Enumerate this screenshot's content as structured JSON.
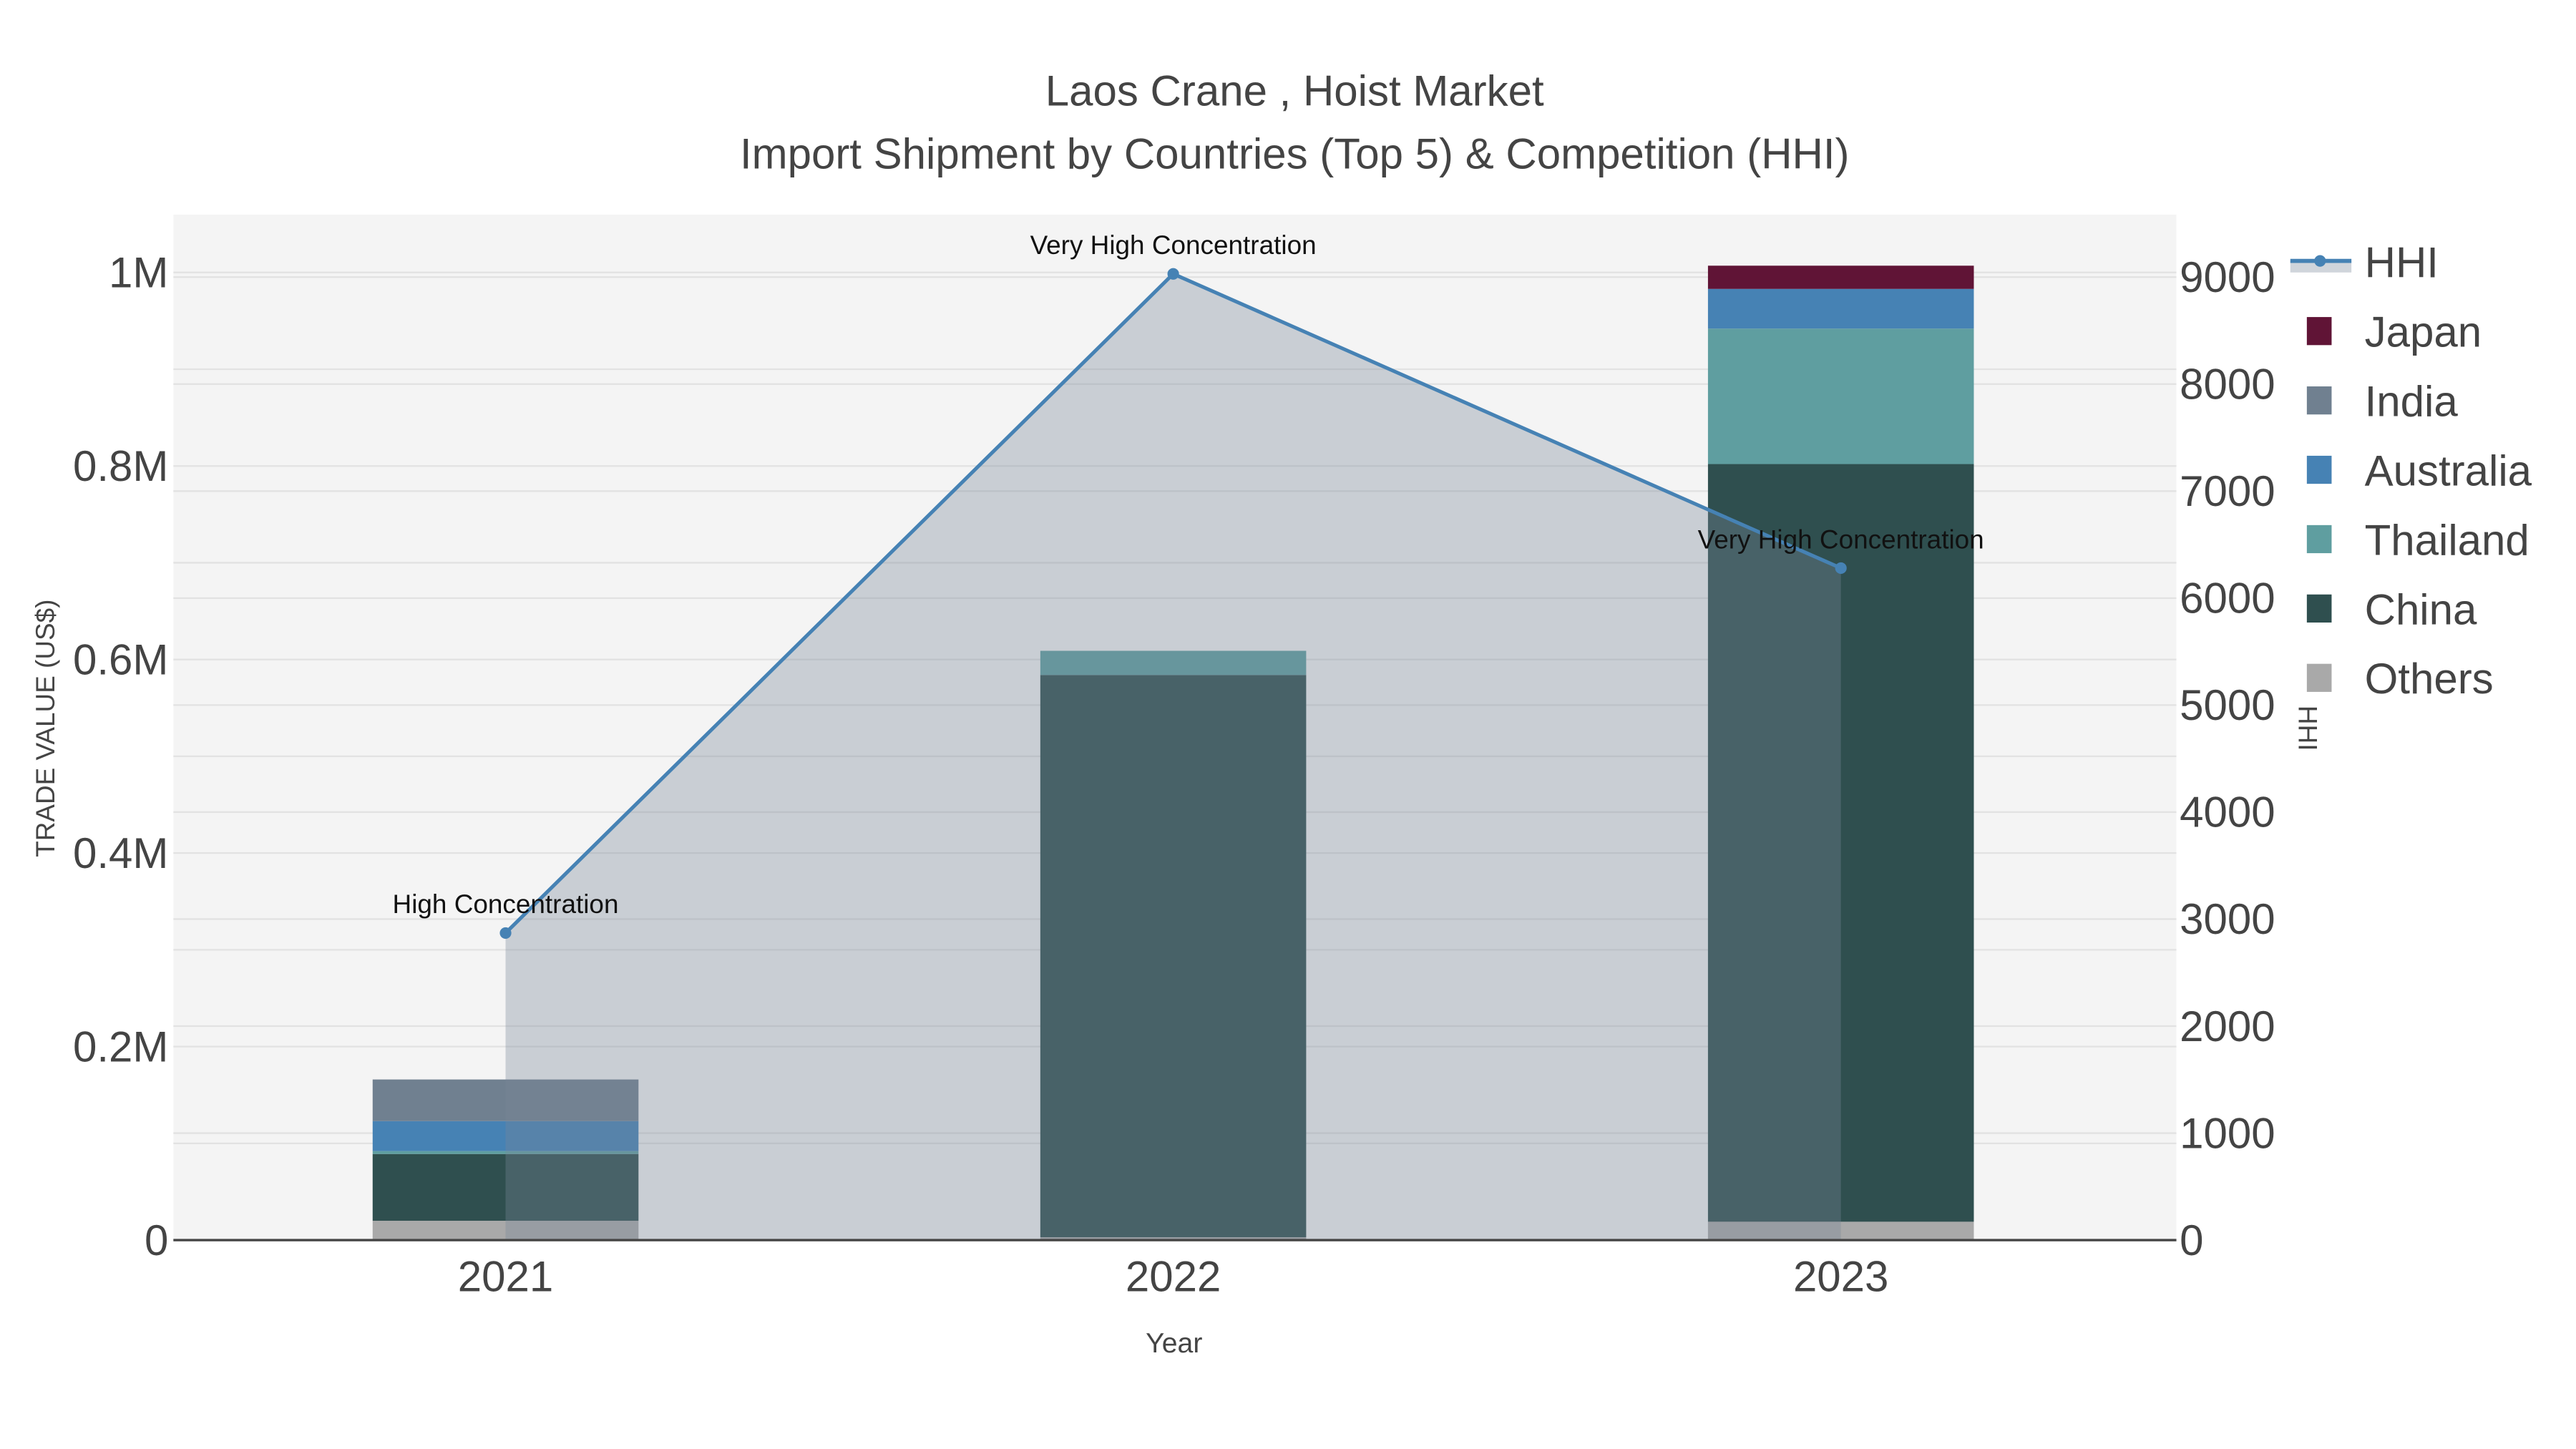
{
  "chart_data": {
    "type": "bar",
    "title": "Laos Crane , Hoist Market",
    "subtitle": "Import Shipment by Countries (Top 5) & Competition (HHI)",
    "xlabel": "Year",
    "ylabel": "TRADE VALUE (US$)",
    "y2label": "HHI",
    "categories": [
      "2021",
      "2022",
      "2023"
    ],
    "ylim": [
      0,
      1060000
    ],
    "y2lim": [
      0,
      9600
    ],
    "yticks": [
      0,
      200000,
      400000,
      600000,
      800000,
      1000000
    ],
    "ytick_labels": [
      "0",
      "0.2M",
      "0.4M",
      "0.6M",
      "0.8M",
      "1M"
    ],
    "y2ticks": [
      0,
      1000,
      2000,
      3000,
      4000,
      5000,
      6000,
      7000,
      8000,
      9000
    ],
    "y2tick_labels": [
      "0",
      "1000",
      "2000",
      "3000",
      "4000",
      "5000",
      "6000",
      "7000",
      "8000",
      "9000"
    ],
    "series": [
      {
        "name": "Others",
        "color": "#a9a9a9",
        "values": [
          20000,
          3000,
          19000
        ]
      },
      {
        "name": "China",
        "color": "#2f4f4f",
        "values": [
          69000,
          581000,
          783000
        ]
      },
      {
        "name": "Thailand",
        "color": "#5f9ea0",
        "values": [
          3000,
          25000,
          140000
        ]
      },
      {
        "name": "Australia",
        "color": "#4682b4",
        "values": [
          31000,
          0,
          41000
        ]
      },
      {
        "name": "India",
        "color": "#708090",
        "values": [
          43000,
          0,
          0
        ]
      },
      {
        "name": "Japan",
        "color": "#601436",
        "values": [
          0,
          0,
          24000
        ]
      }
    ],
    "hhi": {
      "name": "HHI",
      "color": "#4682b4",
      "values": [
        2870,
        9030,
        6280
      ],
      "annotations": [
        "High Concentration",
        "Very High Concentration",
        "Very High Concentration"
      ]
    },
    "legend": [
      "HHI",
      "Japan",
      "India",
      "Australia",
      "Thailand",
      "China",
      "Others"
    ],
    "legend_position": "top-right",
    "grid": true
  }
}
